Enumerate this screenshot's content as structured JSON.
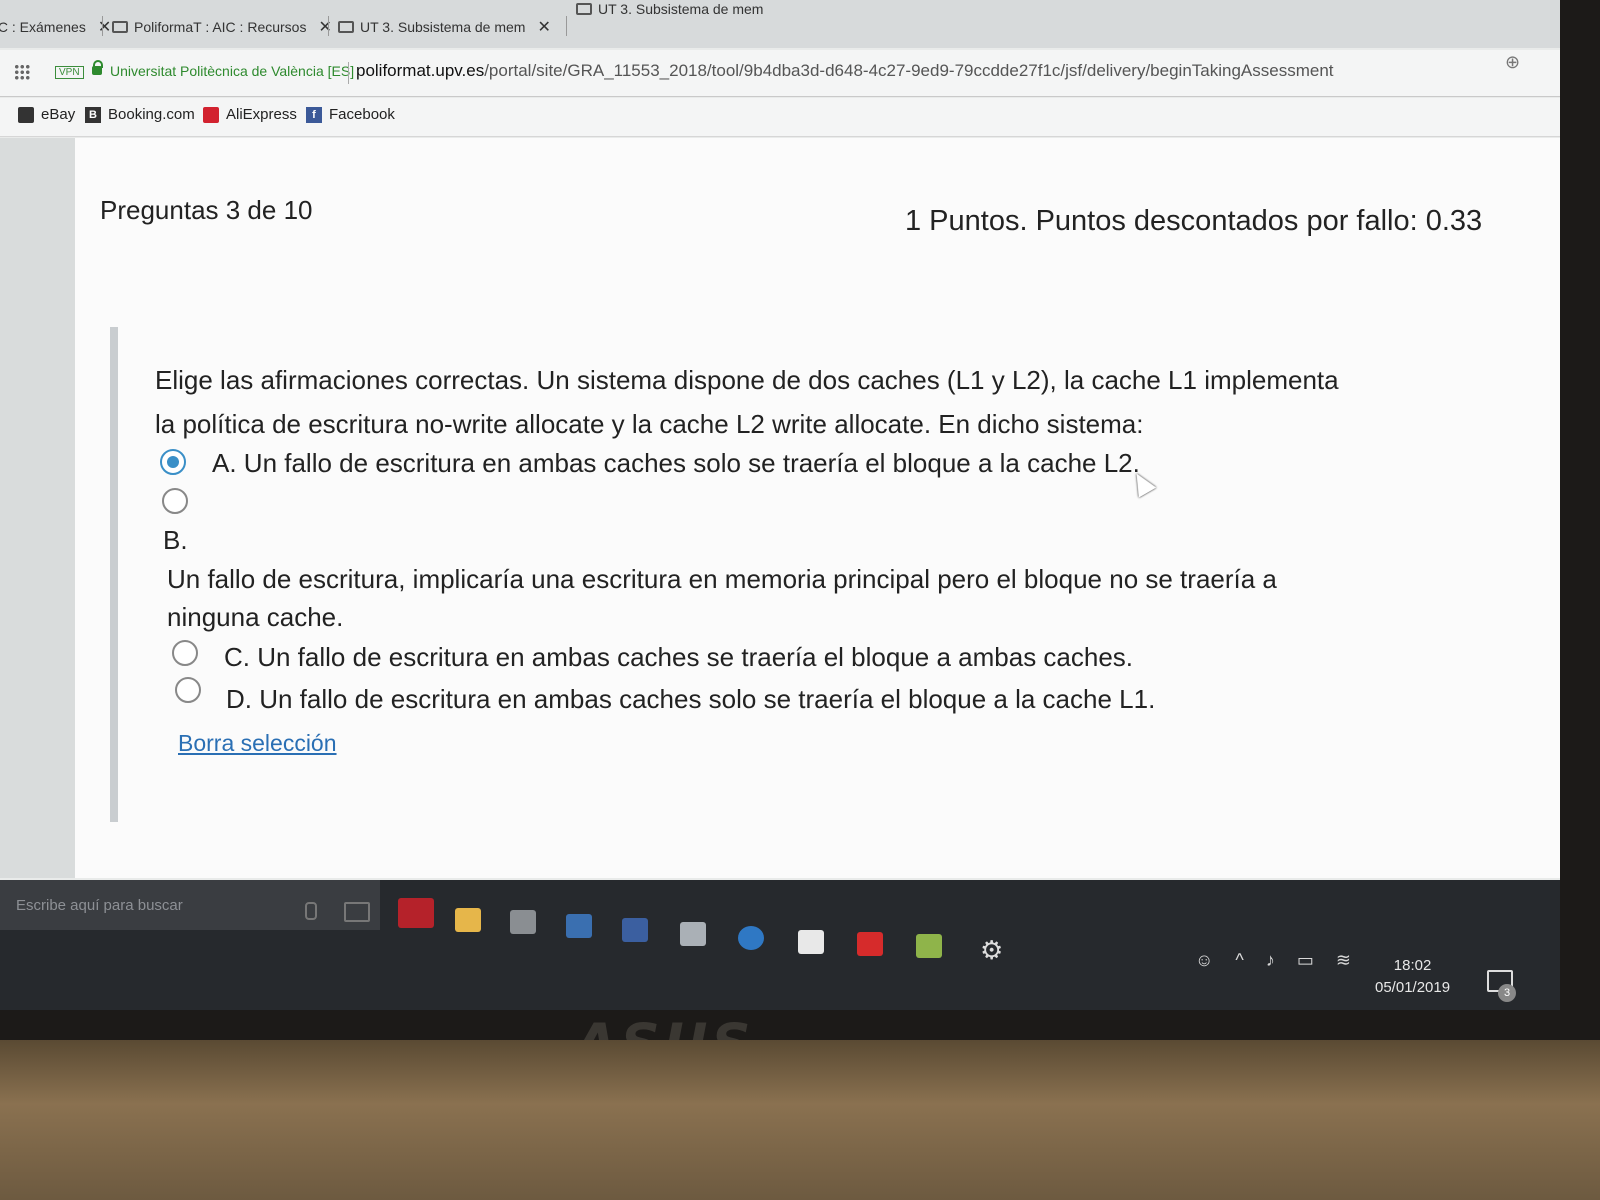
{
  "tabs": [
    {
      "label": "IC : Exámenes",
      "close": "✕"
    },
    {
      "label": "PoliformaT : AIC : Recursos",
      "close": "✕"
    },
    {
      "label": "UT 3. Subsistema de mem",
      "close": "✕"
    },
    {
      "label": "UT 3. Subsistema de mem",
      "close": "✕"
    }
  ],
  "address": {
    "vpn_badge": "VPN",
    "site_name": "Universitat Politècnica de València [ES]",
    "url_host": "poliformat.upv.es",
    "url_path": "/portal/site/GRA_11553_2018/tool/9b4dba3d-d648-4c27-9ed9-79ccdde27f1c/jsf/delivery/beginTakingAssessment"
  },
  "bookmarks": [
    {
      "label": "eBay",
      "icon": "shopping-bag-icon"
    },
    {
      "label": "Booking.com",
      "icon": "B"
    },
    {
      "label": "AliExpress",
      "icon": "aliexpress-icon"
    },
    {
      "label": "Facebook",
      "icon": "f"
    }
  ],
  "question": {
    "counter": "Preguntas 3 de 10",
    "points": "1 Puntos. Puntos descontados por fallo: 0.33",
    "text": "Elige las afirmaciones correctas. Un sistema dispone de dos caches (L1 y L2), la cache L1 implementa la política de escritura no-write allocate y la cache L2 write allocate. En dicho sistema:",
    "options": {
      "a": "A. Un fallo de escritura en ambas caches solo se traería el bloque a la cache L2.",
      "b_label": "B.",
      "b": "Un fallo de escritura, implicaría una escritura en memoria principal pero el bloque no se traería a ninguna cache.",
      "c": "C. Un fallo de escritura en ambas caches se traería el bloque a ambas caches.",
      "d": "D. Un fallo de escritura en ambas caches solo se traería el bloque a la cache L1."
    },
    "selected": "A",
    "clear_link": "Borra selección"
  },
  "taskbar": {
    "search_placeholder": "Escribe aquí para buscar",
    "time": "18:02",
    "date": "05/01/2019",
    "notifications": "3"
  },
  "bezel_logo": "ASUS",
  "colors": {
    "accent": "#3a8fc7",
    "link": "#2a6fb4",
    "secure": "#2e8a2e"
  }
}
